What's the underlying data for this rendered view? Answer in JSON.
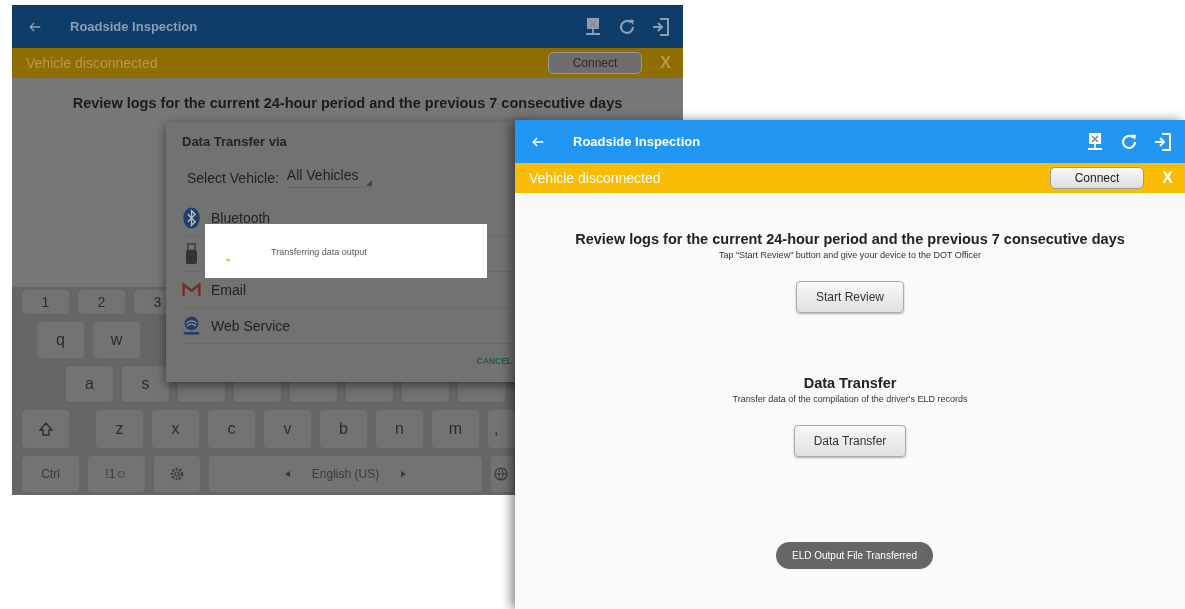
{
  "screens": [
    {
      "dimmed": true,
      "title": "Roadside Inspection",
      "banner": {
        "text": "Vehicle disconnected",
        "button": "Connect",
        "close": "X"
      },
      "sections": [
        {
          "title": "Review logs for the current 24-hour period and the previous 7 consecutive days"
        }
      ],
      "dialog": {
        "title": "Data Transfer via",
        "select_label": "Select Vehicle:",
        "select_value": "All Vehicles",
        "options": [
          {
            "kind": "bluetooth",
            "label": "Bluetooth"
          },
          {
            "kind": "usb"
          },
          {
            "kind": "email",
            "label": "Email"
          },
          {
            "kind": "web",
            "label": "Web Service"
          }
        ],
        "cancel": "CANCEL"
      },
      "progress": {
        "text": "Transferring data output"
      },
      "keyboard": {
        "rows": [
          {
            "keys": [
              {
                "kind": "char",
                "label": "1"
              },
              {
                "kind": "char",
                "label": "2"
              },
              {
                "kind": "char",
                "label": "3"
              }
            ]
          },
          {
            "keys": [
              {
                "kind": "char",
                "label": "q"
              },
              {
                "kind": "char",
                "label": "w"
              }
            ]
          },
          {
            "keys": [
              {
                "kind": "char",
                "label": "a"
              },
              {
                "kind": "char",
                "label": "s"
              },
              {
                "kind": "blank"
              },
              {
                "kind": "blank"
              },
              {
                "kind": "blank"
              },
              {
                "kind": "blank"
              },
              {
                "kind": "blank"
              },
              {
                "kind": "blank"
              }
            ]
          },
          {
            "keys": [
              {
                "kind": "shift"
              },
              {
                "kind": "char",
                "label": "z"
              },
              {
                "kind": "char",
                "label": "x"
              },
              {
                "kind": "char",
                "label": "c"
              },
              {
                "kind": "char",
                "label": "v"
              },
              {
                "kind": "char",
                "label": "b"
              },
              {
                "kind": "char",
                "label": "n"
              },
              {
                "kind": "char",
                "label": "m"
              },
              {
                "kind": "edge",
                "label": ","
              }
            ]
          },
          {
            "keys": [
              {
                "kind": "wide",
                "label": "Ctrl"
              },
              {
                "kind": "wide",
                "label": "!1☺"
              },
              {
                "kind": "settings"
              },
              {
                "kind": "space",
                "label": "English (US)"
              },
              {
                "kind": "globe"
              }
            ]
          }
        ]
      }
    },
    {
      "dimmed": false,
      "title": "Roadside Inspection",
      "banner": {
        "text": "Vehicle disconnected",
        "button": "Connect",
        "close": "X"
      },
      "sections": [
        {
          "title": "Review logs for the current 24-hour period and the previous 7 consecutive days",
          "subtitle": "Tap \"Start Review\" button and give your device to the DOT Officer",
          "button": "Start Review"
        },
        {
          "title": "Data Transfer",
          "subtitle": "Transfer data of the compilation of the driver's ELD records",
          "button": "Data Transfer"
        }
      ],
      "toast": "ELD Output File Transferred"
    }
  ]
}
